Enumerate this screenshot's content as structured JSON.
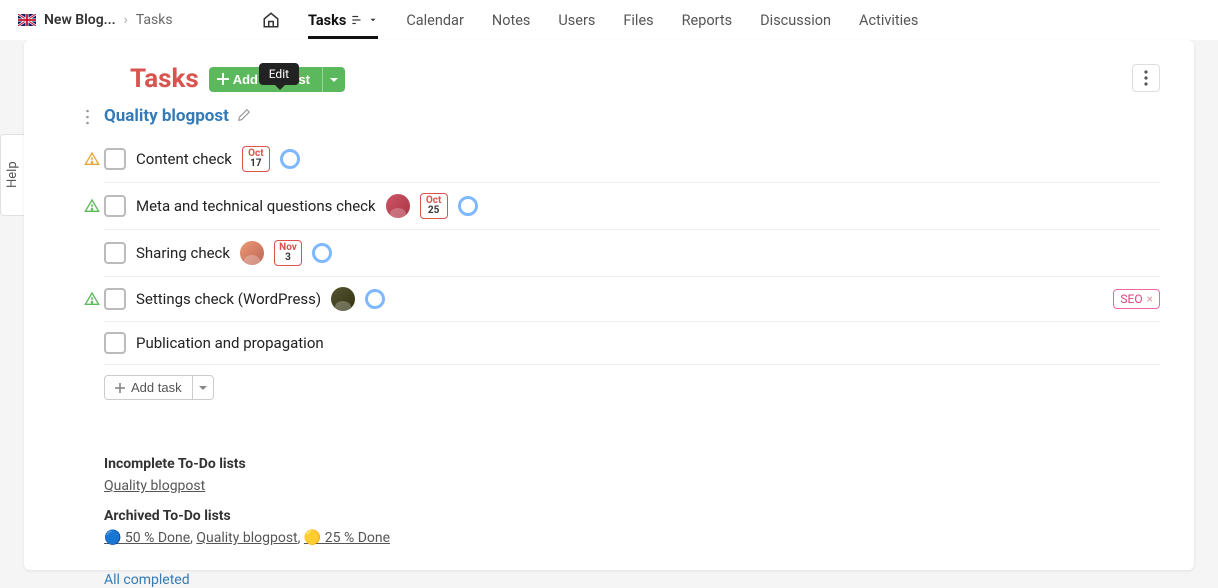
{
  "breadcrumb": {
    "project": "New Blog...",
    "current": "Tasks"
  },
  "nav": {
    "home": "Home",
    "items": [
      "Tasks",
      "Calendar",
      "Notes",
      "Users",
      "Files",
      "Reports",
      "Discussion",
      "Activities"
    ],
    "active": "Tasks"
  },
  "help_label": "Help",
  "page": {
    "title": "Tasks",
    "add_button": "Add task list",
    "tooltip": "Edit"
  },
  "list": {
    "title": "Quality blogpost",
    "tasks": [
      {
        "name": "Content check",
        "warn": "orange",
        "date_m": "Oct",
        "date_d": "17",
        "avatar": null,
        "tag": null
      },
      {
        "name": "Meta and technical questions check",
        "warn": "green",
        "date_m": "Oct",
        "date_d": "25",
        "avatar": "a1",
        "tag": null
      },
      {
        "name": "Sharing check",
        "warn": null,
        "date_m": "Nov",
        "date_d": "3",
        "avatar": "a2",
        "tag": null
      },
      {
        "name": "Settings check (WordPress)",
        "warn": "green",
        "date_m": null,
        "date_d": null,
        "avatar": "a3",
        "tag": "SEO"
      },
      {
        "name": "Publication and propagation",
        "warn": null,
        "date_m": null,
        "date_d": null,
        "avatar": null,
        "tag": null
      }
    ],
    "add_task": "Add task"
  },
  "footer": {
    "incomplete_heading": "Incomplete To-Do lists",
    "incomplete_link": "Quality blogpost",
    "archived_heading": "Archived To-Do lists",
    "archived_links": [
      "🔵 50 % Done",
      "Quality blogpost",
      "🟡 25 % Done"
    ],
    "all_completed": "All completed"
  }
}
